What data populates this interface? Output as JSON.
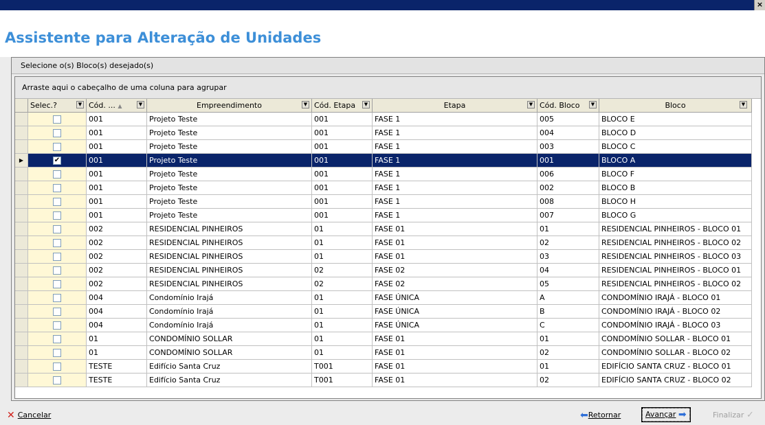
{
  "window": {
    "close_glyph": "×"
  },
  "header": {
    "title": "Assistente para Alteração de Unidades"
  },
  "panel": {
    "title": "Selecione o(s) Bloco(s) desejado(s)"
  },
  "grid": {
    "group_hint": "Arraste aqui o cabeçalho de uma coluna para agrupar",
    "columns": {
      "selec": "Selec.?",
      "cod_emp": "Cód. ...",
      "empreendimento": "Empreendimento",
      "cod_etapa": "Cód. Etapa",
      "etapa": "Etapa",
      "cod_bloco": "Cód. Bloco",
      "bloco": "Bloco"
    },
    "rows": [
      {
        "checked": false,
        "cod_emp": "001",
        "empreendimento": "Projeto Teste",
        "cod_etapa": "001",
        "etapa": "FASE 1",
        "cod_bloco": "005",
        "bloco": "BLOCO E"
      },
      {
        "checked": false,
        "cod_emp": "001",
        "empreendimento": "Projeto Teste",
        "cod_etapa": "001",
        "etapa": "FASE 1",
        "cod_bloco": "004",
        "bloco": "BLOCO D"
      },
      {
        "checked": false,
        "cod_emp": "001",
        "empreendimento": "Projeto Teste",
        "cod_etapa": "001",
        "etapa": "FASE 1",
        "cod_bloco": "003",
        "bloco": "BLOCO C"
      },
      {
        "checked": true,
        "selected": true,
        "cod_emp": "001",
        "empreendimento": "Projeto Teste",
        "cod_etapa": "001",
        "etapa": "FASE 1",
        "cod_bloco": "001",
        "bloco": "BLOCO A"
      },
      {
        "checked": false,
        "cod_emp": "001",
        "empreendimento": "Projeto Teste",
        "cod_etapa": "001",
        "etapa": "FASE 1",
        "cod_bloco": "006",
        "bloco": "BLOCO F"
      },
      {
        "checked": false,
        "cod_emp": "001",
        "empreendimento": "Projeto Teste",
        "cod_etapa": "001",
        "etapa": "FASE 1",
        "cod_bloco": "002",
        "bloco": "BLOCO B"
      },
      {
        "checked": false,
        "cod_emp": "001",
        "empreendimento": "Projeto Teste",
        "cod_etapa": "001",
        "etapa": "FASE 1",
        "cod_bloco": "008",
        "bloco": "BLOCO H"
      },
      {
        "checked": false,
        "cod_emp": "001",
        "empreendimento": "Projeto Teste",
        "cod_etapa": "001",
        "etapa": "FASE 1",
        "cod_bloco": "007",
        "bloco": "BLOCO G"
      },
      {
        "checked": false,
        "cod_emp": "002",
        "empreendimento": "RESIDENCIAL PINHEIROS",
        "cod_etapa": "01",
        "etapa": "FASE 01",
        "cod_bloco": "01",
        "bloco": "RESIDENCIAL PINHEIROS - BLOCO 01"
      },
      {
        "checked": false,
        "cod_emp": "002",
        "empreendimento": "RESIDENCIAL PINHEIROS",
        "cod_etapa": "01",
        "etapa": "FASE 01",
        "cod_bloco": "02",
        "bloco": "RESIDENCIAL PINHEIROS - BLOCO 02"
      },
      {
        "checked": false,
        "cod_emp": "002",
        "empreendimento": "RESIDENCIAL PINHEIROS",
        "cod_etapa": "01",
        "etapa": "FASE 01",
        "cod_bloco": "03",
        "bloco": "RESIDENCIAL PINHEIROS - BLOCO 03"
      },
      {
        "checked": false,
        "cod_emp": "002",
        "empreendimento": "RESIDENCIAL PINHEIROS",
        "cod_etapa": "02",
        "etapa": "FASE 02",
        "cod_bloco": "04",
        "bloco": "RESIDENCIAL PINHEIROS - BLOCO 01"
      },
      {
        "checked": false,
        "cod_emp": "002",
        "empreendimento": "RESIDENCIAL PINHEIROS",
        "cod_etapa": "02",
        "etapa": "FASE 02",
        "cod_bloco": "05",
        "bloco": "RESIDENCIAL PINHEIROS - BLOCO 02"
      },
      {
        "checked": false,
        "cod_emp": "004",
        "empreendimento": "Condomínio Irajá",
        "cod_etapa": "01",
        "etapa": "FASE ÚNICA",
        "cod_bloco": "A",
        "bloco": "CONDOMÍNIO IRAJÁ - BLOCO 01"
      },
      {
        "checked": false,
        "cod_emp": "004",
        "empreendimento": "Condomínio Irajá",
        "cod_etapa": "01",
        "etapa": "FASE ÚNICA",
        "cod_bloco": "B",
        "bloco": "CONDOMÍNIO IRAJÁ - BLOCO 02"
      },
      {
        "checked": false,
        "cod_emp": "004",
        "empreendimento": "Condomínio Irajá",
        "cod_etapa": "01",
        "etapa": "FASE ÚNICA",
        "cod_bloco": "C",
        "bloco": "CONDOMÍNIO IRAJÁ - BLOCO 03"
      },
      {
        "checked": false,
        "cod_emp": "01",
        "empreendimento": "CONDOMÍNIO SOLLAR",
        "cod_etapa": "01",
        "etapa": "FASE 01",
        "cod_bloco": "01",
        "bloco": "CONDOMÍNIO SOLLAR - BLOCO 01"
      },
      {
        "checked": false,
        "cod_emp": "01",
        "empreendimento": "CONDOMÍNIO SOLLAR",
        "cod_etapa": "01",
        "etapa": "FASE 01",
        "cod_bloco": "02",
        "bloco": "CONDOMÍNIO SOLLAR - BLOCO 02"
      },
      {
        "checked": false,
        "cod_emp": "TESTE",
        "empreendimento": "Edifício Santa Cruz",
        "cod_etapa": "T001",
        "etapa": "FASE 01",
        "cod_bloco": "01",
        "bloco": "EDIFÍCIO SANTA CRUZ - BLOCO 01"
      },
      {
        "checked": false,
        "cod_emp": "TESTE",
        "empreendimento": "Edifício Santa Cruz",
        "cod_etapa": "T001",
        "etapa": "FASE 01",
        "cod_bloco": "02",
        "bloco": "EDIFÍCIO SANTA CRUZ - BLOCO 02"
      }
    ]
  },
  "footer": {
    "cancel_label": "Cancelar",
    "back_label": "Retornar",
    "next_label": "Avançar",
    "finish_label": "Finalizar"
  },
  "colors": {
    "title": "#3d8fd8",
    "titlebar": "#0a246a",
    "selection": "#0a246a",
    "select_column": "#fff8d6"
  }
}
